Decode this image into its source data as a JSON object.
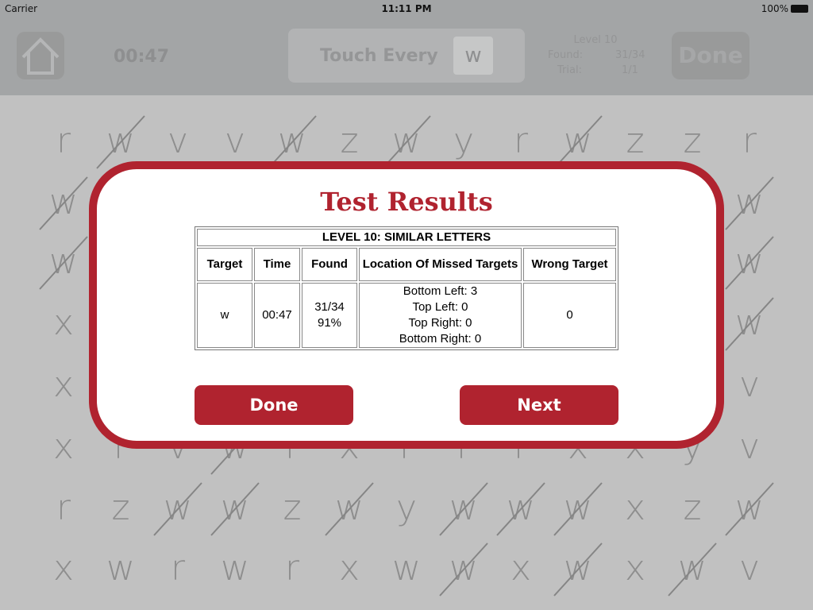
{
  "status_bar": {
    "carrier": "Carrier",
    "time": "11:11 PM",
    "battery": "100%"
  },
  "header": {
    "timer": "00:47",
    "touch_label": "Touch Every",
    "target_letter": "w",
    "level": "Level 10",
    "found_label": "Found:",
    "found_value": "31/34",
    "trial_label": "Trial:",
    "trial_value": "1/1",
    "done_label": "Done"
  },
  "grid": {
    "rows": [
      [
        {
          "c": "r"
        },
        {
          "c": "w",
          "x": true
        },
        {
          "c": "v"
        },
        {
          "c": "v"
        },
        {
          "c": "w",
          "x": true
        },
        {
          "c": "z"
        },
        {
          "c": "w",
          "x": true
        },
        {
          "c": "y"
        },
        {
          "c": "r"
        },
        {
          "c": "w",
          "x": true
        },
        {
          "c": "z"
        },
        {
          "c": "z"
        },
        {
          "c": "r"
        }
      ],
      [
        {
          "c": "w",
          "x": true
        },
        null,
        null,
        null,
        null,
        null,
        null,
        null,
        null,
        null,
        null,
        null,
        {
          "c": "w",
          "x": true
        }
      ],
      [
        {
          "c": "w",
          "x": true
        },
        null,
        null,
        null,
        null,
        null,
        null,
        null,
        null,
        null,
        null,
        null,
        {
          "c": "w",
          "x": true
        }
      ],
      [
        {
          "c": "x"
        },
        null,
        null,
        null,
        null,
        null,
        null,
        null,
        null,
        null,
        null,
        null,
        {
          "c": "w",
          "x": true
        }
      ],
      [
        {
          "c": "x"
        },
        null,
        null,
        null,
        null,
        null,
        null,
        null,
        null,
        null,
        null,
        null,
        {
          "c": "v"
        }
      ],
      [
        {
          "c": "x"
        },
        {
          "c": "r"
        },
        {
          "c": "v"
        },
        {
          "c": "w",
          "x": true
        },
        {
          "c": "r"
        },
        {
          "c": "x"
        },
        {
          "c": "r"
        },
        {
          "c": "r"
        },
        {
          "c": "r"
        },
        {
          "c": "x"
        },
        {
          "c": "x"
        },
        {
          "c": "y"
        },
        {
          "c": "v"
        }
      ],
      [
        {
          "c": "r"
        },
        {
          "c": "z"
        },
        {
          "c": "w",
          "x": true
        },
        {
          "c": "w",
          "x": true
        },
        {
          "c": "z"
        },
        {
          "c": "w",
          "x": true
        },
        {
          "c": "y"
        },
        {
          "c": "w",
          "x": true
        },
        {
          "c": "w",
          "x": true
        },
        {
          "c": "w",
          "x": true
        },
        {
          "c": "x"
        },
        {
          "c": "z"
        },
        {
          "c": "w",
          "x": true
        }
      ],
      [
        {
          "c": "x"
        },
        {
          "c": "w"
        },
        {
          "c": "r"
        },
        {
          "c": "w"
        },
        {
          "c": "r"
        },
        {
          "c": "x"
        },
        {
          "c": "w"
        },
        {
          "c": "w",
          "x": true
        },
        {
          "c": "x"
        },
        {
          "c": "w",
          "x": true
        },
        {
          "c": "x"
        },
        {
          "c": "w",
          "x": true
        },
        {
          "c": "v"
        }
      ]
    ]
  },
  "dialog": {
    "title": "Test Results",
    "table": {
      "caption": "LEVEL 10: SIMILAR LETTERS",
      "headers": [
        "Target",
        "Time",
        "Found",
        "Location Of Missed Targets",
        "Wrong Target"
      ],
      "row": {
        "target": "w",
        "time": "00:47",
        "found": "31/34",
        "found_pct": "91%",
        "missed": [
          "Bottom Left: 3",
          "Top Left: 0",
          "Top Right: 0",
          "Bottom Right: 0"
        ],
        "wrong": "0"
      }
    },
    "done_label": "Done",
    "next_label": "Next"
  },
  "colors": {
    "accent": "#b0232f",
    "overlay": "#c1c1c1",
    "letter": "#8e8e8e"
  }
}
